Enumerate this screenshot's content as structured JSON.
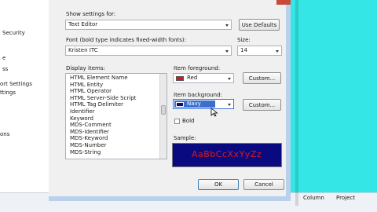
{
  "sidebar": {
    "items": [
      "Security",
      "e",
      "ss",
      "ort Settings",
      "ttings",
      "ons"
    ]
  },
  "dialog": {
    "show_settings_label": "Show settings for:",
    "show_settings_value": "Text Editor",
    "use_defaults_label": "Use Defaults",
    "font_label": "Font (bold type indicates fixed-width fonts):",
    "font_value": "Kristen ITC",
    "size_label": "Size:",
    "size_value": "14",
    "display_items_label": "Display items:",
    "display_items": [
      "HTML Element Name",
      "HTML Entity",
      "HTML Operator",
      "HTML Server-Side Script",
      "HTML Tag Delimiter",
      "Identifier",
      "Keyword",
      "MDS-Comment",
      "MDS-Identifier",
      "MDS-Keyword",
      "MDS-Number",
      "MDS-String"
    ],
    "item_foreground_label": "Item foreground:",
    "item_foreground_value": "Red",
    "item_foreground_color": "#d01c1c",
    "custom_label": "Custom...",
    "item_background_label": "Item background:",
    "item_background_value": "Navy",
    "item_background_color": "#0a0a7a",
    "bold_label": "Bold",
    "sample_label": "Sample:",
    "sample_text": "AaBbCcXxYyZz",
    "sample_bg": "#0a0a80",
    "sample_fg": "#e01818",
    "ok_label": "OK",
    "cancel_label": "Cancel"
  },
  "statusbar": {
    "column_label": "Column",
    "project_label": "Project"
  }
}
